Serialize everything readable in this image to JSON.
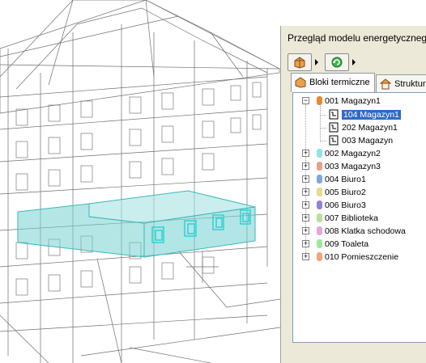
{
  "panel": {
    "title": "Przegląd modelu energetycznego",
    "toolbar": [
      {
        "icon": "model-icon",
        "accent": "#d9822b"
      },
      {
        "icon": "refresh-icon",
        "accent": "#2ea043"
      }
    ]
  },
  "tabs": [
    {
      "label": "Bloki termiczne",
      "icon": "thermal-block-icon",
      "active": true
    },
    {
      "label": "Struktur",
      "icon": "structure-icon",
      "active": false
    }
  ],
  "tree": {
    "root": {
      "label": "001 Magazyn1",
      "color": "#e8892b",
      "expanded": true
    },
    "children": [
      {
        "label": "104 Magazyn1",
        "selected": true
      },
      {
        "label": "202 Magazyn1",
        "selected": false
      },
      {
        "label": "003 Magazyn",
        "selected": false
      }
    ],
    "items": [
      {
        "label": "002 Magazyn2",
        "color": "#8fe3ea"
      },
      {
        "label": "003 Magazyn3",
        "color": "#e7a08b"
      },
      {
        "label": "004 Biuro1",
        "color": "#7fa8d9"
      },
      {
        "label": "005 Biuro2",
        "color": "#ead98f"
      },
      {
        "label": "006 Biuro3",
        "color": "#8f84d6"
      },
      {
        "label": "007 Biblioteka",
        "color": "#b9e09a"
      },
      {
        "label": "008 Klatka schodowa",
        "color": "#e3a8d9"
      },
      {
        "label": "009 Toaleta",
        "color": "#9ee89a"
      },
      {
        "label": "010 Pomieszczenie",
        "color": "#f0a67a"
      }
    ]
  }
}
